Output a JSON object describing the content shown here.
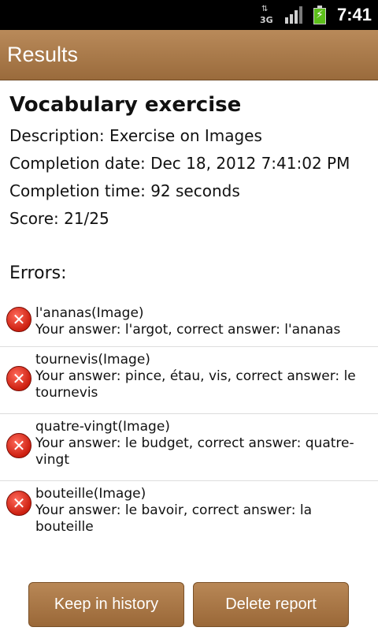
{
  "status_bar": {
    "network": "3G",
    "time": "7:41"
  },
  "header": {
    "title": "Results"
  },
  "report": {
    "title": "Vocabulary exercise",
    "description": "Description: Exercise on Images",
    "completion_date": "Completion date: Dec 18, 2012 7:41:02 PM",
    "completion_time": "Completion time: 92 seconds",
    "score": "Score: 21/25",
    "errors_heading": "Errors:"
  },
  "errors": [
    {
      "word": "l'ananas(Image)",
      "answer": "Your answer: l'argot, correct answer: l'ananas"
    },
    {
      "word": "tournevis(Image)",
      "answer": "Your answer: pince, étau, vis, correct answer: le tournevis"
    },
    {
      "word": "quatre-vingt(Image)",
      "answer": "Your answer: le budget, correct answer: quatre-vingt"
    },
    {
      "word": "bouteille(Image)",
      "answer": "Your answer: le bavoir, correct answer: la bouteille"
    }
  ],
  "buttons": {
    "keep": "Keep in history",
    "delete": "Delete report"
  },
  "colors": {
    "accent": "#a87746",
    "error": "#cc1f10"
  }
}
